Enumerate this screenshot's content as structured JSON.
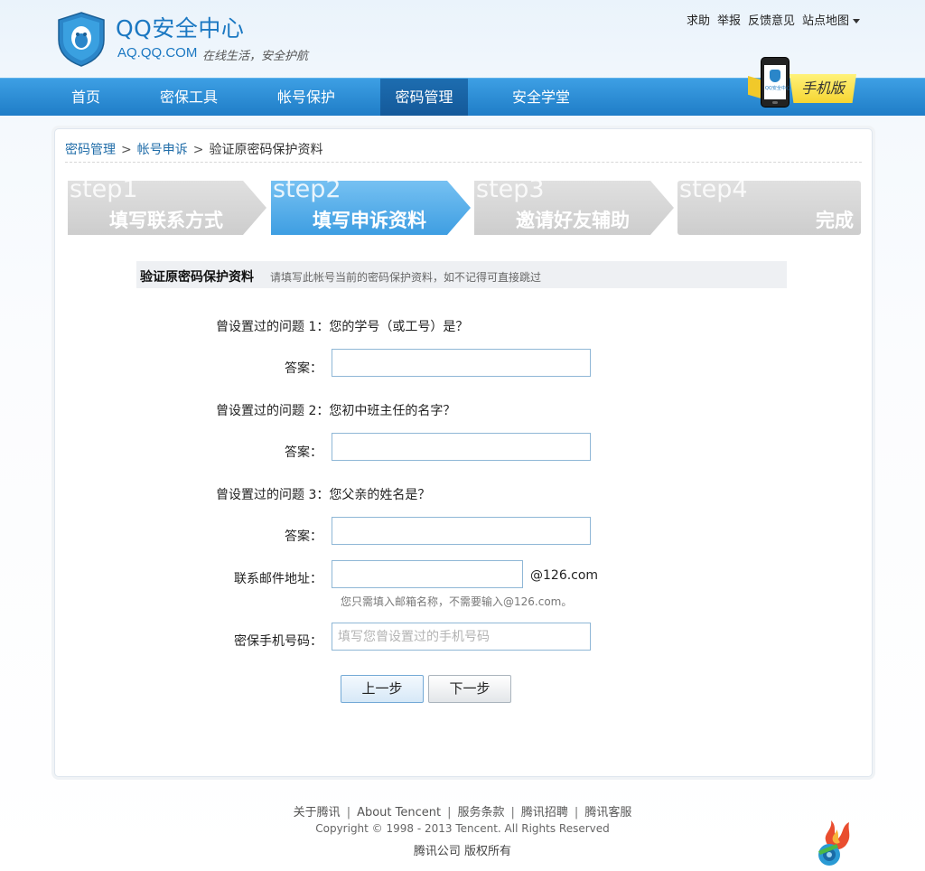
{
  "brand": {
    "title": "QQ安全中心",
    "domain": "AQ.QQ.COM",
    "slogan": "在线生活，安全护航",
    "color": "#1b78c2"
  },
  "top_links": [
    "求助",
    "举报",
    "反馈意见",
    "站点地图"
  ],
  "nav": {
    "items": [
      "首页",
      "密保工具",
      "帐号保护",
      "密码管理",
      "安全学堂"
    ],
    "active": "密码管理"
  },
  "mobile_badge": {
    "label": "手机版",
    "phone_text": "QQ安全中心"
  },
  "breadcrumb": {
    "items": [
      "密码管理",
      "帐号申诉"
    ],
    "current": "验证原密码保护资料",
    "separator": ">"
  },
  "steps": [
    {
      "num": "step1",
      "label": "填写联系方式",
      "state": "inactive"
    },
    {
      "num": "step2",
      "label": "填写申诉资料",
      "state": "active"
    },
    {
      "num": "step3",
      "label": "邀请好友辅助",
      "state": "inactive"
    },
    {
      "num": "step4",
      "label": "完成",
      "state": "inactive"
    }
  ],
  "section": {
    "title": "验证原密码保护资料",
    "hint": "请填写此帐号当前的密码保护资料，如不记得可直接跳过"
  },
  "form": {
    "questions": [
      {
        "label": "曾设置过的问题 1：您的学号（或工号）是？",
        "answer_label": "答案：",
        "value": ""
      },
      {
        "label": "曾设置过的问题 2：您初中班主任的名字？",
        "answer_label": "答案：",
        "value": ""
      },
      {
        "label": "曾设置过的问题 3：您父亲的姓名是？",
        "answer_label": "答案：",
        "value": ""
      }
    ],
    "email": {
      "label": "联系邮件地址：",
      "value": "",
      "suffix": "@126.com",
      "hint": "您只需填入邮箱名称，不需要输入@126.com。"
    },
    "phone": {
      "label": "密保手机号码：",
      "value": "",
      "placeholder": "填写您曾设置过的手机号码"
    },
    "prev_label": "上一步",
    "next_label": "下一步"
  },
  "footer": {
    "links": [
      "关于腾讯",
      "About Tencent",
      "服务条款",
      "腾讯招聘",
      "腾讯客服"
    ],
    "copyright": "Copyright © 1998 - 2013 Tencent. All Rights Reserved",
    "company": "腾讯公司 版权所有"
  },
  "colors": {
    "nav": "#2b8ad4",
    "active_step": "#4fa8e8",
    "inactive_step": "#d4d4d4"
  }
}
